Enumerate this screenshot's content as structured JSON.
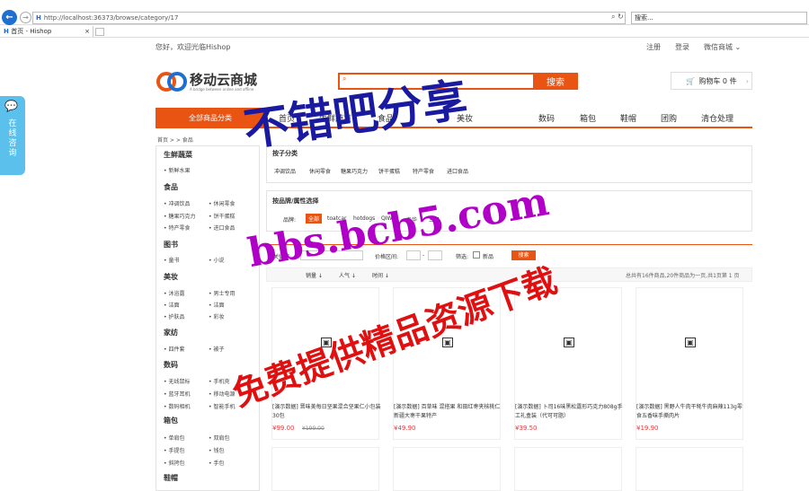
{
  "browser": {
    "url": "http://localhost:36373/browse/category/17",
    "search_placeholder": "搜索...",
    "tab_title": "首页 - Hishop"
  },
  "header": {
    "welcome": "您好，欢迎光临Hishop",
    "links": [
      "注册",
      "登录",
      "微信商城"
    ]
  },
  "logo": {
    "name": "移动云商城",
    "tagline": "A bridge between online and offline"
  },
  "search": {
    "button": "搜索"
  },
  "cart": {
    "label": "购物车 0 件"
  },
  "nav": {
    "all_categories": "全部商品分类",
    "items": [
      "首页",
      "生鲜蔬菜",
      "食品",
      "美妆",
      "数码",
      "箱包",
      "鞋帽",
      "团购",
      "清仓处理"
    ]
  },
  "breadcrumb": "首页 > > 食品",
  "sidebar": [
    {
      "title": "生鲜蔬菜",
      "links": [
        "新鲜水果"
      ]
    },
    {
      "title": "食品",
      "links": [
        "休闲零食",
        "冲调饮品",
        "巧克力",
        "糖果巧克力",
        "饼干蛋糕",
        "特产零食",
        "进口食品"
      ]
    },
    {
      "title": "图书",
      "links": [
        "童书",
        "小说"
      ]
    },
    {
      "title": "美妆",
      "links": [
        "男士专用",
        "沐浴露",
        "洁面",
        "护肤品",
        "彩妆"
      ]
    },
    {
      "title": "家纺",
      "links": [
        "四件套",
        "被子"
      ]
    },
    {
      "title": "数码",
      "links": [
        "无线鼠标",
        "手机壳",
        "蓝牙耳机",
        "移动电源",
        "数码相机",
        "智能手机"
      ]
    },
    {
      "title": "箱包",
      "links": [
        "单肩包",
        "双肩包",
        "手提包",
        "钱包",
        "斜挎包",
        "手包"
      ]
    },
    {
      "title": "鞋帽",
      "links": []
    }
  ],
  "subcategory": {
    "title": "按子分类",
    "items": [
      "冲调饮品",
      "休闲零食",
      "糖果巧克力",
      "饼干蛋糕",
      "特产零食",
      "进口食品"
    ]
  },
  "brand": {
    "title": "按品牌/属性选择",
    "label": "品牌:",
    "items": [
      "全部",
      "toatcar",
      "hotdogs",
      "QIW",
      "泰华",
      "三只"
    ]
  },
  "filter": {
    "keyword": "关键字:",
    "price": "价格区间:",
    "dash": "-",
    "filter_label": "筛选:",
    "new_label": "新品",
    "go": "搜索"
  },
  "sort": {
    "items": [
      "销量",
      "人气",
      "时间"
    ],
    "summary": "总共有16件商品,20件商品为一页,共1页第 1 页"
  },
  "products": [
    {
      "title": "[演示数据] 晋味美每日坚果混合坚果仁小包装30包",
      "price": "¥99.00",
      "old": "¥199.00"
    },
    {
      "title": "[演示数据] 百草味 混搭果 和田红枣夹核桃仁 新疆大枣干果特产",
      "price": "¥49.90",
      "old": ""
    },
    {
      "title": "[演示数据] 卜司16味黑松露形巧克力808g手工礼盒装（代可可脂）",
      "price": "¥39.50",
      "old": ""
    },
    {
      "title": "[演示数据] 黑野人牛肉干牦牛肉麻辣113g零食五香味手撕肉片",
      "price": "¥19.90",
      "old": ""
    }
  ],
  "chat": "在线咨询",
  "watermarks": [
    "不错吧分享",
    "bbs.bcb5.com",
    "免费提供精品资源下载"
  ],
  "colors": {
    "accent": "#ea5413",
    "price": "#e4393c",
    "chat": "#5bc0eb",
    "watermark_blue": "#1a1aa0",
    "watermark_purple": "#b000c8",
    "watermark_red": "#e01010"
  }
}
